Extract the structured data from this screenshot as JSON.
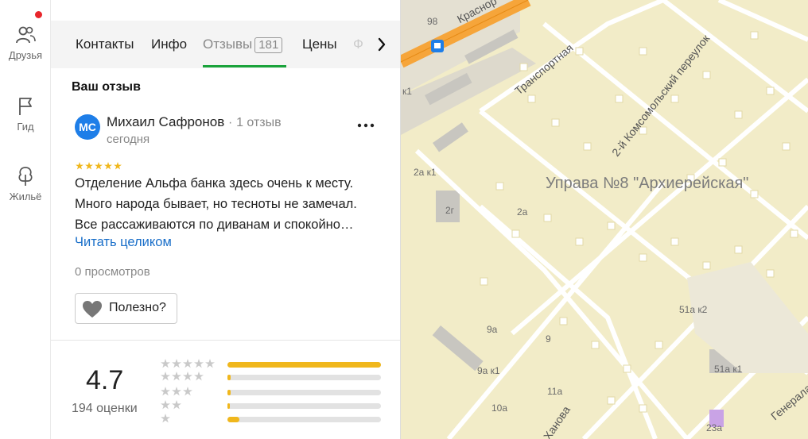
{
  "sidebar": {
    "items": [
      {
        "label": "Друзья",
        "icon": "friends-icon",
        "has_notification": true
      },
      {
        "label": "Гид",
        "icon": "flag-icon"
      },
      {
        "label": "Жильё",
        "icon": "tree-house-icon"
      }
    ],
    "notification_color": "#e8262b"
  },
  "tabs": {
    "items": [
      {
        "label": "Контакты"
      },
      {
        "label": "Инфо"
      },
      {
        "label": "Отзывы",
        "count": "181",
        "active": true
      },
      {
        "label": "Цены"
      }
    ],
    "faded": "Ф",
    "accent": "#1aa33b"
  },
  "review": {
    "section_title": "Ваш отзыв",
    "avatar_initials": "МС",
    "author": "Михаил Сафронов",
    "author_reviews": "1 отзыв",
    "date": "сегодня",
    "rating": 5,
    "text": "Отделение Альфа банка здесь очень к месту. Много народа бывает, но тесноты не замечал. Все рассаживаются по диванам и спокойно…",
    "read_more": "Читать целиком",
    "views": "0 просмотров",
    "useful_label": "Полезно?"
  },
  "summary": {
    "rating": "4.7",
    "count_label": "194 оценки",
    "distribution": [
      {
        "stars": 5,
        "fraction": 1.0
      },
      {
        "stars": 4,
        "fraction": 0.02
      },
      {
        "stars": 3,
        "fraction": 0.02
      },
      {
        "stars": 2,
        "fraction": 0.01
      },
      {
        "stars": 1,
        "fraction": 0.08
      }
    ],
    "bar_color": "#f0b71c"
  },
  "map": {
    "district": "Управа №8 \"Архиерейская\"",
    "streets": {
      "transportnaya": "Транспортная",
      "komsomolsky": "2-й Комсомольский переулок",
      "krasnoar": "Краснор",
      "khanova": "Ханова",
      "generala": "Генерала"
    },
    "house_numbers": {
      "h98": "98",
      "hk1": "к1",
      "h2ak1": "2а к1",
      "h2g": "2г",
      "h2a": "2а",
      "h9a": "9а",
      "h9": "9",
      "h9ak1": "9а к1",
      "h11a": "11а",
      "h10a": "10а",
      "h51ak2": "51а к2",
      "h51ak1": "51а к1",
      "h23a": "23а"
    }
  }
}
